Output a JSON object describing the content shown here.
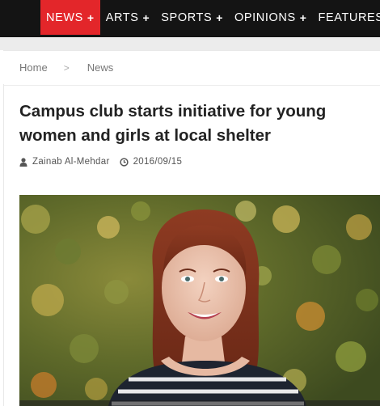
{
  "nav": {
    "items": [
      {
        "label": "NEWS",
        "has_plus": true,
        "active": true
      },
      {
        "label": "ARTS",
        "has_plus": true
      },
      {
        "label": "SPORTS",
        "has_plus": true
      },
      {
        "label": "OPINIONS",
        "has_plus": true
      },
      {
        "label": "FEATURES",
        "has_plus": false
      }
    ],
    "plus_glyph": "+",
    "active_color": "#e3262a"
  },
  "breadcrumb": {
    "home": "Home",
    "separator": ">",
    "current": "News"
  },
  "article": {
    "title": "Campus club starts initiative for young women and girls at local shelter",
    "author": "Zainab Al-Mehdar",
    "date": "2016/09/15",
    "author_icon": "user-icon",
    "date_icon": "clock-icon"
  }
}
